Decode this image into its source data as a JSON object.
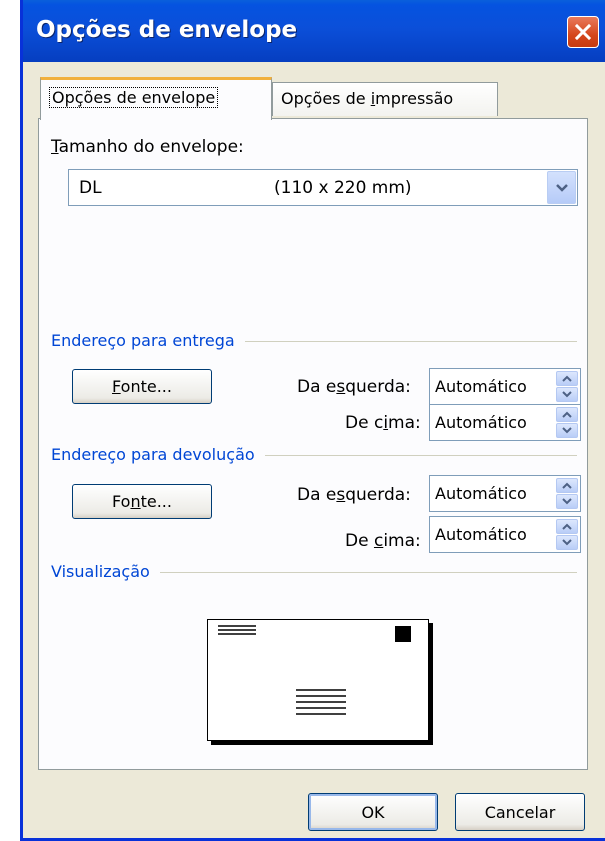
{
  "window": {
    "title": "Opções de envelope"
  },
  "tabs": [
    {
      "label": "Opções de envelope",
      "active": true
    },
    {
      "label_pre": "Opções de ",
      "label_u": "i",
      "label_post": "mpressão",
      "active": false
    }
  ],
  "envelope_size": {
    "label_u": "T",
    "label_rest": "amanho do envelope:",
    "selected_name": "DL",
    "selected_dims": "(110 x 220 mm)"
  },
  "delivery": {
    "title": "Endereço para entrega",
    "font_button": {
      "u": "F",
      "rest": "onte..."
    },
    "from_left": {
      "pre": "Da e",
      "u": "s",
      "post": "querda:",
      "value": "Automático"
    },
    "from_top": {
      "pre": "De c",
      "u": "i",
      "post": "ma:",
      "value": "Automático"
    }
  },
  "return": {
    "title": "Endereço para devolução",
    "font_button": {
      "pre": "Fo",
      "u": "n",
      "post": "te..."
    },
    "from_left": {
      "pre": "Da e",
      "u": "s",
      "post": "querda:",
      "value": "Automático"
    },
    "from_top": {
      "pre": "De ",
      "u": "c",
      "post": "ima:",
      "value": "Automático"
    }
  },
  "preview": {
    "title": "Visualização"
  },
  "buttons": {
    "ok": "OK",
    "cancel": "Cancelar"
  },
  "colors": {
    "title_bar": "#0553e0",
    "group_title": "#0046d5",
    "close": "#d5471c"
  }
}
